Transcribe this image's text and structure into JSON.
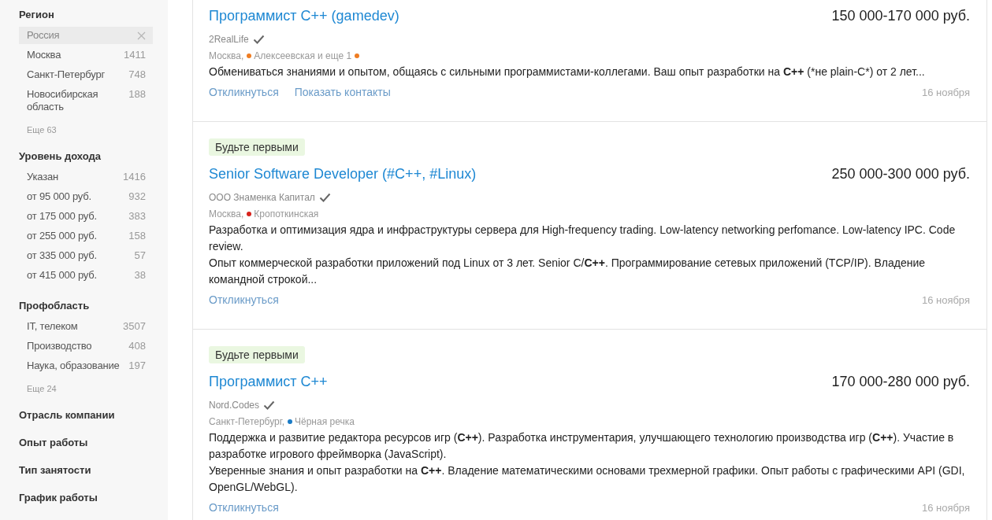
{
  "filter_groups": [
    {
      "title": "Регион",
      "items": [
        {
          "label": "Россия",
          "selected": true
        },
        {
          "label": "Москва",
          "count": "1411",
          "selected": false
        },
        {
          "label": "Санкт-Петербург",
          "count": "748",
          "selected": false
        },
        {
          "label": "Новосибирская область",
          "count": "188",
          "selected": false
        }
      ],
      "more": "Еще 63"
    },
    {
      "title": "Уровень дохода",
      "items": [
        {
          "label": "Указан",
          "count": "1416",
          "selected": false
        },
        {
          "label": "от 95 000 руб.",
          "count": "932",
          "selected": false
        },
        {
          "label": "от 175 000 руб.",
          "count": "383",
          "selected": false
        },
        {
          "label": "от 255 000 руб.",
          "count": "158",
          "selected": false
        },
        {
          "label": "от 335 000 руб.",
          "count": "57",
          "selected": false
        },
        {
          "label": "от 415 000 руб.",
          "count": "38",
          "selected": false
        }
      ]
    },
    {
      "title": "Профобласть",
      "items": [
        {
          "label": "IT, телеком",
          "count": "3507",
          "selected": false
        },
        {
          "label": "Производство",
          "count": "408",
          "selected": false
        },
        {
          "label": "Наука, образование",
          "count": "197",
          "selected": false
        }
      ],
      "more": "Еще 24"
    }
  ],
  "collapsed_filters": [
    "Отрасль компании",
    "Опыт работы",
    "Тип занятости",
    "График работы"
  ],
  "vacancies": [
    {
      "title": "Программист C++ (gamedev)",
      "salary": "150 000-170 000 руб.",
      "company": "2RealLife",
      "verified": true,
      "location": [
        {
          "kind": "text",
          "text": "Москва,"
        },
        {
          "kind": "dot",
          "color": "#ef7d23"
        },
        {
          "kind": "text",
          "text": "Алексеевская и еще 1"
        },
        {
          "kind": "dot",
          "color": "#ef7d23"
        }
      ],
      "description": [
        [
          {
            "text": "Обмениваться знаниями и опытом, общаясь с сильными программистами-коллегами. Ваш опыт разработки на ",
            "bold": false
          },
          {
            "text": "C++",
            "bold": true
          },
          {
            "text": " (*не plain-C*) от 2 лет...",
            "bold": false
          }
        ]
      ],
      "actions": [
        "Откликнуться",
        "Показать контакты"
      ],
      "date": "16 ноября"
    },
    {
      "badge": "Будьте первыми",
      "title": "Senior Software Developer (#C++, #Linux)",
      "salary": "250 000-300 000 руб.",
      "company": "ООО Знаменка Капитал",
      "verified": true,
      "location": [
        {
          "kind": "text",
          "text": "Москва,"
        },
        {
          "kind": "dot",
          "color": "#d8231c"
        },
        {
          "kind": "text",
          "text": "Кропоткинская"
        }
      ],
      "description": [
        [
          {
            "text": "Разработка и оптимизация ядра и инфраструктуры сервера для High-frequency trading. Low-latency networking perfomance. Low-latency IPC. Code review.",
            "bold": false
          }
        ],
        [
          {
            "text": "Опыт коммерческой разработки приложений под Linux от 3 лет. Senior C/",
            "bold": false
          },
          {
            "text": "C++",
            "bold": true
          },
          {
            "text": ". Программирование сетевых приложений (TCP/IP). Владение командной строкой...",
            "bold": false
          }
        ]
      ],
      "actions": [
        "Откликнуться"
      ],
      "date": "16 ноября"
    },
    {
      "badge": "Будьте первыми",
      "title": "Программист C++",
      "salary": "170 000-280 000 руб.",
      "company": "Nord.Codes",
      "verified": true,
      "location": [
        {
          "kind": "text",
          "text": "Санкт-Петербург,"
        },
        {
          "kind": "dot",
          "color": "#1b7cc6"
        },
        {
          "kind": "text",
          "text": "Чёрная речка"
        }
      ],
      "description": [
        [
          {
            "text": "Поддержка и развитие редактора ресурсов игр (",
            "bold": false
          },
          {
            "text": "C++",
            "bold": true
          },
          {
            "text": "). Разработка инструментария, улучшающего технологию производства игр (",
            "bold": false
          },
          {
            "text": "C++",
            "bold": true
          },
          {
            "text": "). Участие в разработке игрового фреймворка (JavaScript).",
            "bold": false
          }
        ],
        [
          {
            "text": "Уверенные знания и опыт разработки на ",
            "bold": false
          },
          {
            "text": "C++",
            "bold": true
          },
          {
            "text": ". Владение математическими основами трехмерной графики. Опыт работы с графическими API (GDI, OpenGL/WebGL).",
            "bold": false
          }
        ]
      ],
      "actions": [
        "Откликнуться"
      ],
      "date": "16 ноября"
    }
  ]
}
